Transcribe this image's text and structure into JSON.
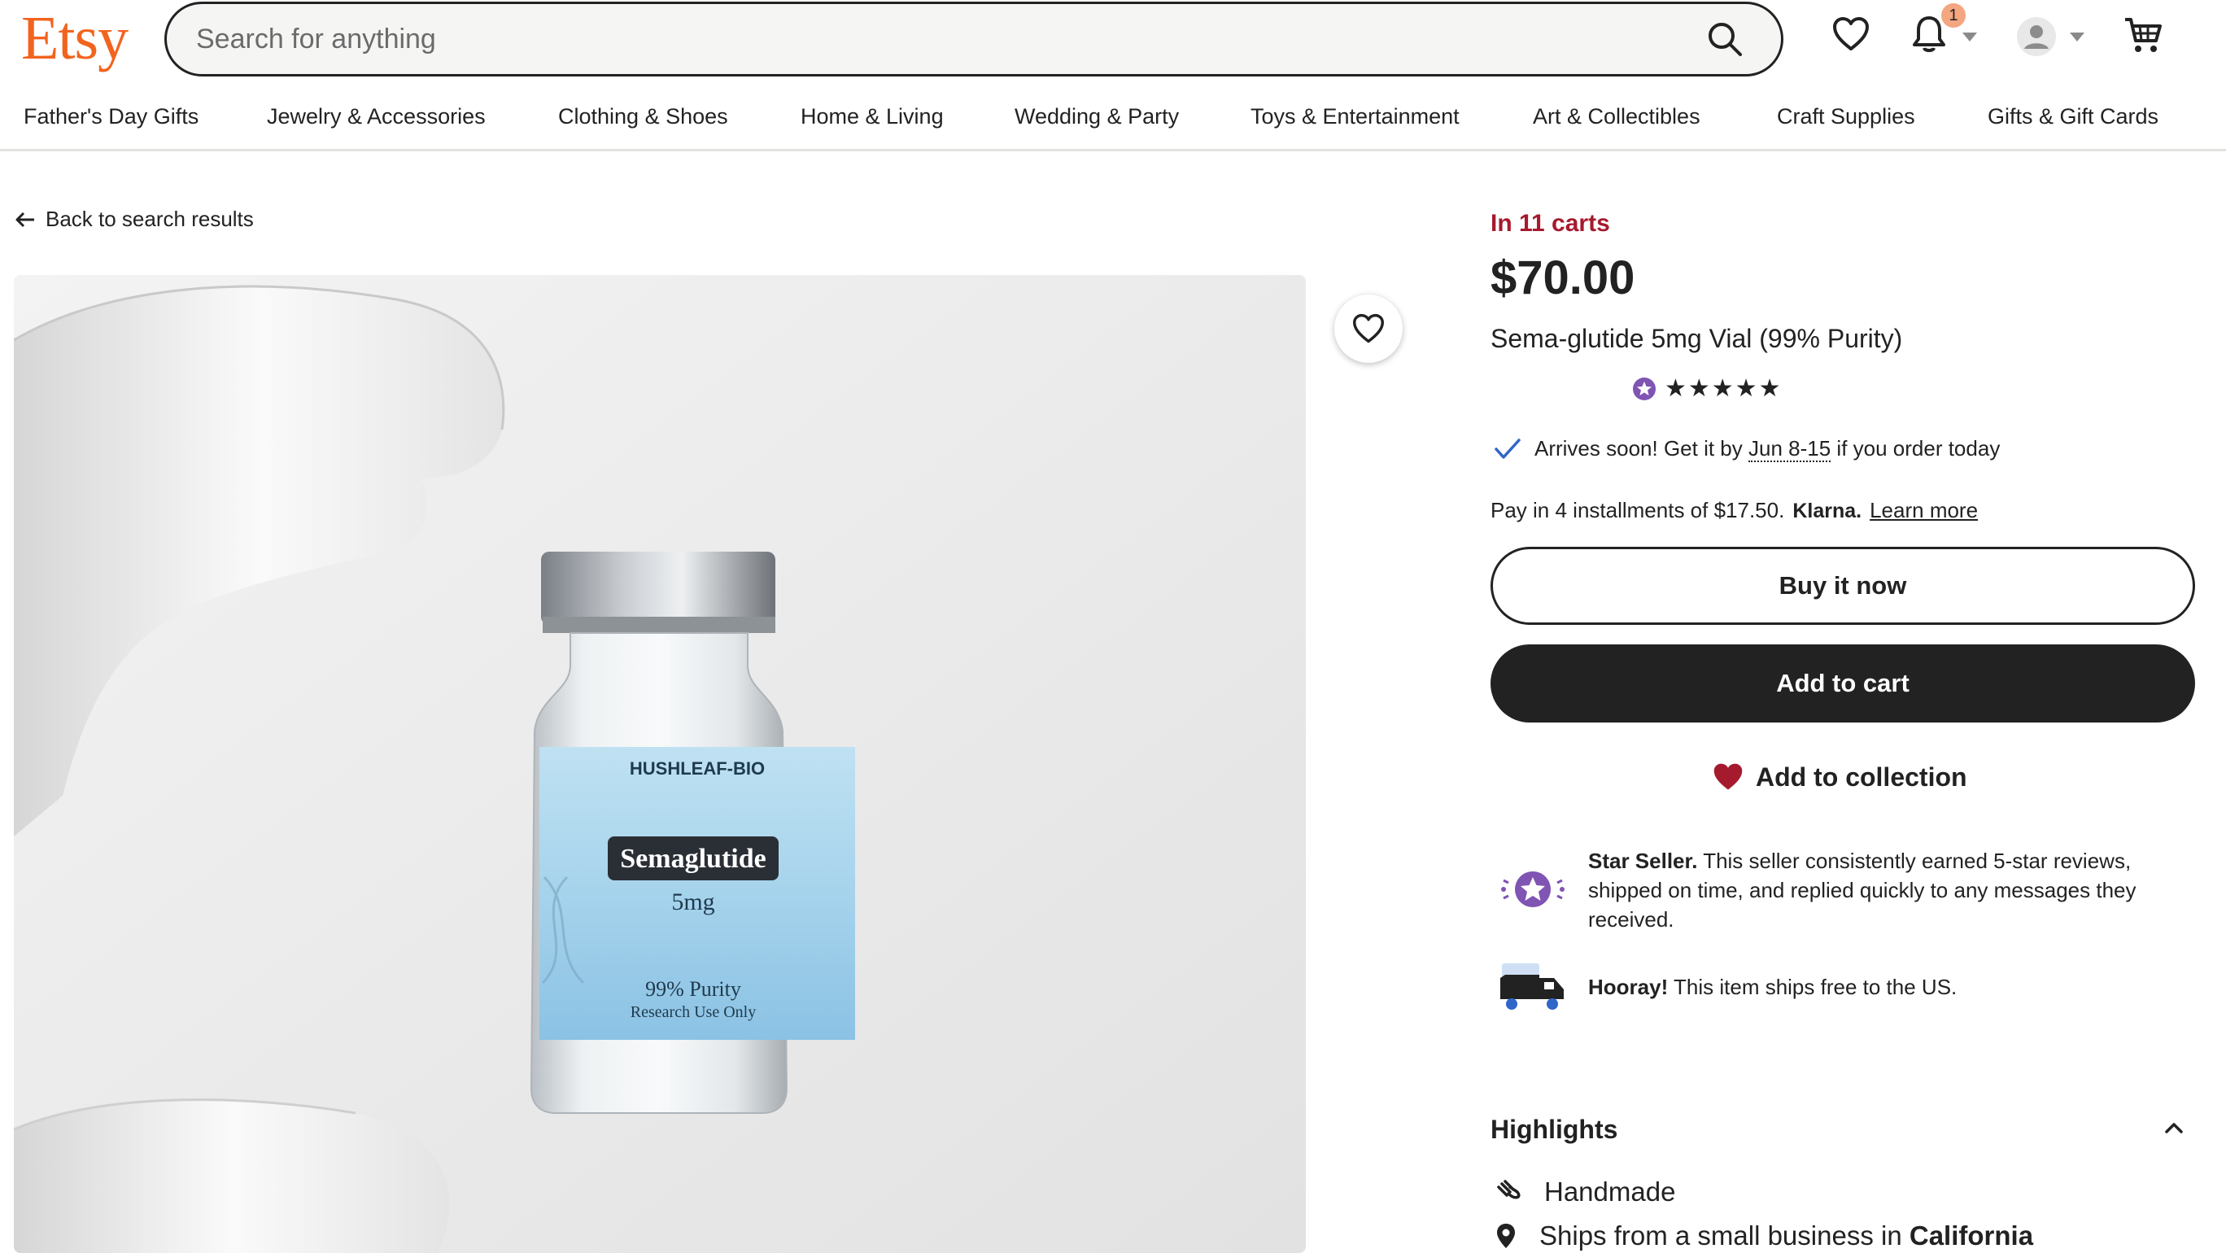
{
  "header": {
    "logo": "Etsy",
    "search_placeholder": "Search for anything",
    "notification_count": "1"
  },
  "nav": {
    "items": [
      "Father's Day Gifts",
      "Jewelry & Accessories",
      "Clothing & Shoes",
      "Home & Living",
      "Wedding & Party",
      "Toys & Entertainment",
      "Art & Collectibles",
      "Craft Supplies",
      "Gifts & Gift Cards"
    ]
  },
  "listing": {
    "back_label": "Back to search results",
    "in_carts": "In 11 carts",
    "price": "$70.00",
    "title": "Sema-glutide 5mg Vial (99% Purity)",
    "rating_stars": "★★★★★",
    "rating_value": 5,
    "arrives_prefix": "Arrives soon! Get it by",
    "arrives_date": "Jun 8-15",
    "arrives_suffix": "if you order today",
    "pay_text": "Pay in 4 installments of $17.50.",
    "klarna": "Klarna.",
    "learn_more": "Learn more",
    "buy_now": "Buy it now",
    "add_to_cart": "Add to cart",
    "add_to_collection": "Add to collection",
    "star_seller_bold": "Star Seller.",
    "star_seller_text": "This seller consistently earned 5-star reviews, shipped on time, and replied quickly to any messages they received.",
    "hooray_bold": "Hooray!",
    "hooray_text": "This item ships free to the US.",
    "highlights_title": "Highlights",
    "highlight_handmade": "Handmade",
    "highlight_ships_prefix": "Ships from a small business in",
    "highlight_ships_location": "California"
  },
  "product_image": {
    "brand": "HUSHLEAF-BIO",
    "drug_name": "Semaglutide",
    "dose": "5mg",
    "purity": "99% Purity",
    "note": "Research Use Only"
  },
  "colors": {
    "brand_orange": "#f1641e",
    "in_carts_red": "#a61a2e",
    "star_seller_purple": "#7f54b3",
    "heart_red": "#a61a2e"
  }
}
